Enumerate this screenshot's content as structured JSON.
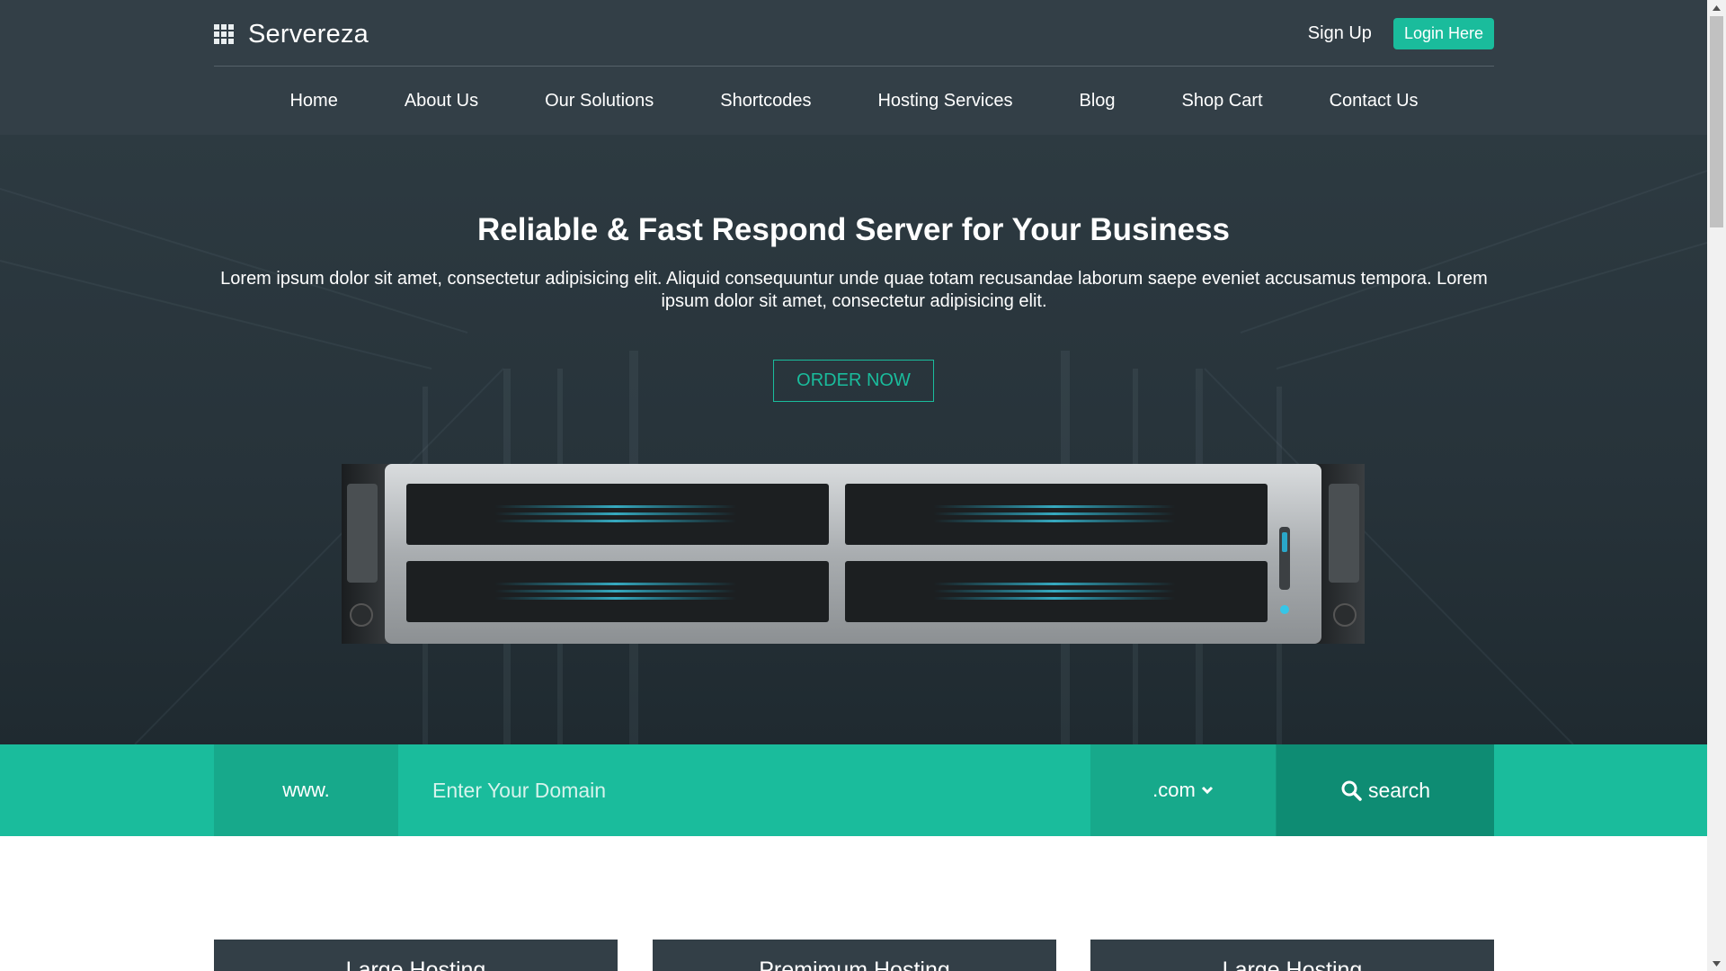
{
  "brand": {
    "name": "Servereza",
    "icon": "grid-logo-icon"
  },
  "auth": {
    "signup": "Sign Up",
    "login": "Login Here"
  },
  "nav": {
    "items": [
      "Home",
      "About Us",
      "Our Solutions",
      "Shortcodes",
      "Hosting Services",
      "Blog",
      "Shop Cart",
      "Contact Us"
    ]
  },
  "hero": {
    "title": "Reliable & Fast Respond Server for Your Business",
    "text": "Lorem ipsum dolor sit amet, consectetur adipisicing elit. Aliquid consequuntur unde quae totam recusandae laborum saepe eveniet accusamus tempora. Lorem ipsum dolor sit amet, consectetur adipisicing elit.",
    "cta": "ORDER NOW"
  },
  "domain_search": {
    "prefix": "www.",
    "placeholder": "Enter Your Domain",
    "tld": ".com",
    "button": "search"
  },
  "plans": [
    "Large Hosting",
    "Premimum Hosting",
    "Large Hosting"
  ],
  "colors": {
    "accent": "#1abc9c",
    "header": "#333f47",
    "accent_dark": "#0e8c73"
  }
}
